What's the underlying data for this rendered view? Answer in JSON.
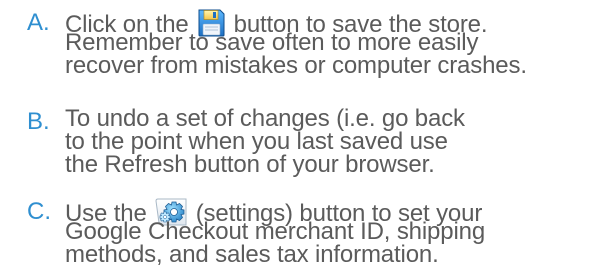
{
  "instructions": {
    "items": [
      {
        "marker": "A.",
        "line1_before": "Click on the ",
        "line1_icon": "floppy-disk-icon",
        "line1_after": " button to save the store.",
        "line2": "Remember to save often to more easily",
        "line3": "recover from mistakes or computer crashes."
      },
      {
        "marker": "B.",
        "line1": "To undo a set of changes (i.e. go back",
        "line2": "to the point when you last saved use",
        "line3": "the Refresh button of your browser."
      },
      {
        "marker": "C.",
        "line1_before": "Use the ",
        "line1_icon": "settings-gear-icon",
        "line1_after": " (settings) button to set your",
        "line2": "Google Checkout merchant ID, shipping",
        "line3": "methods, and sales tax information."
      }
    ]
  },
  "colors": {
    "marker": "#2f8fd0",
    "text": "#5b5b5b"
  }
}
